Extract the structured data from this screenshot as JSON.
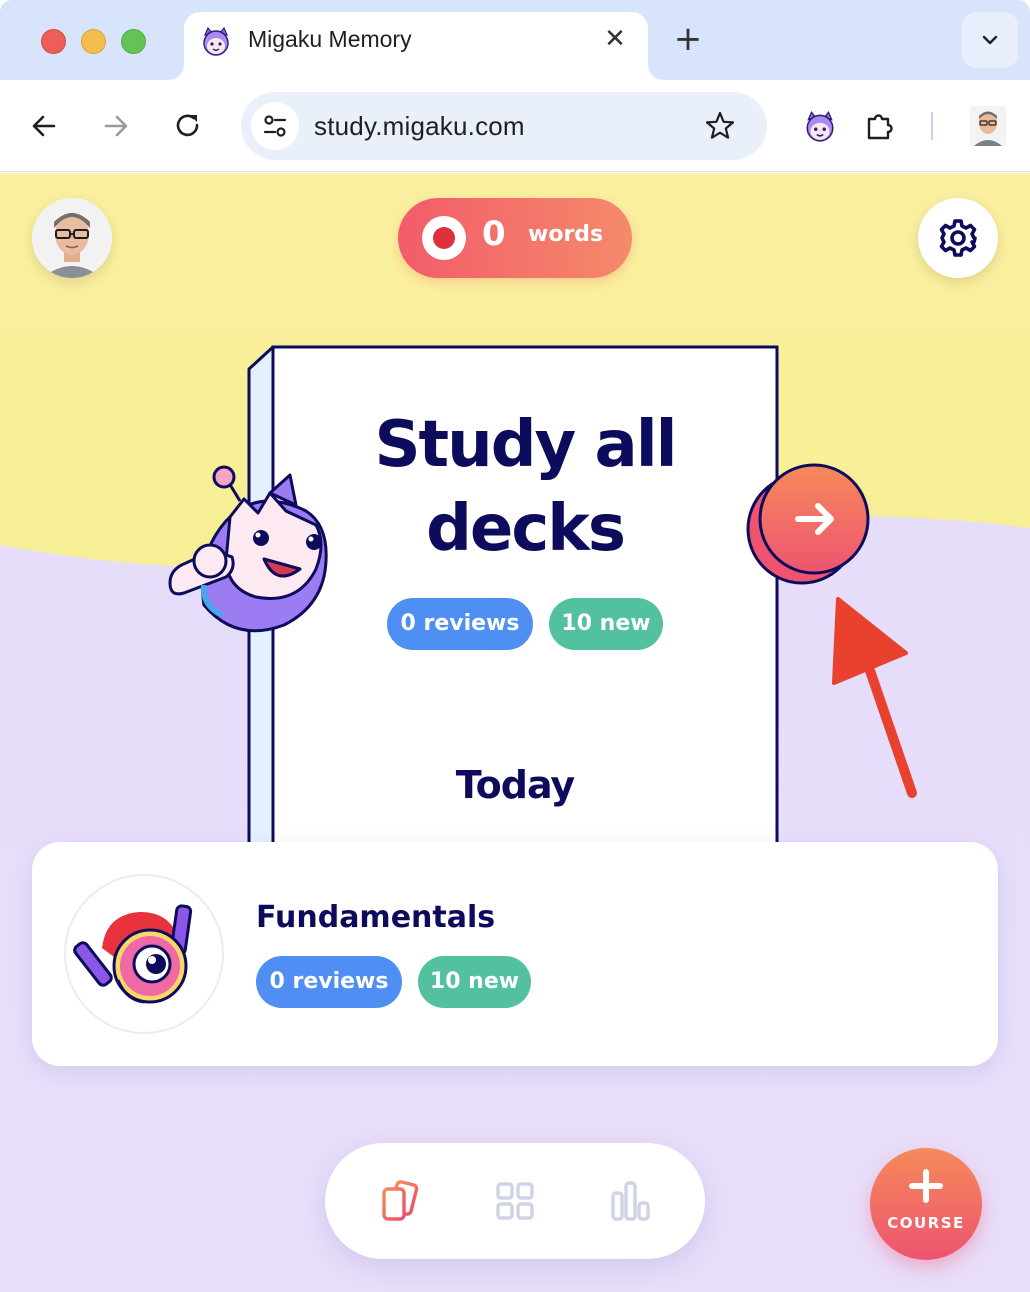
{
  "browser": {
    "tab_title": "Migaku Memory",
    "url": "study.migaku.com",
    "tab_close_glyph": "✕",
    "new_tab_glyph": "+"
  },
  "header": {
    "words_count": "0",
    "words_label": "words"
  },
  "study_all": {
    "title_line1": "Study all",
    "title_line2": "decks",
    "reviews_badge": "0 reviews",
    "new_badge": "10 new"
  },
  "section_title": "Today",
  "decks": [
    {
      "title": "Fundamentals",
      "reviews_badge": "0 reviews",
      "new_badge": "10 new"
    }
  ],
  "bottom_nav": {
    "items": [
      {
        "icon": "cards-icon",
        "active": true
      },
      {
        "icon": "grid-icon",
        "active": false
      },
      {
        "icon": "stats-icon",
        "active": false
      }
    ]
  },
  "fab": {
    "label": "COURSE"
  },
  "colors": {
    "brand_navy": "#0d0b5b",
    "reviews_blue": "#4f8ef2",
    "new_green": "#53c1a0",
    "accent_coral": "#f25c6a",
    "annotation_red": "#e8422e"
  }
}
